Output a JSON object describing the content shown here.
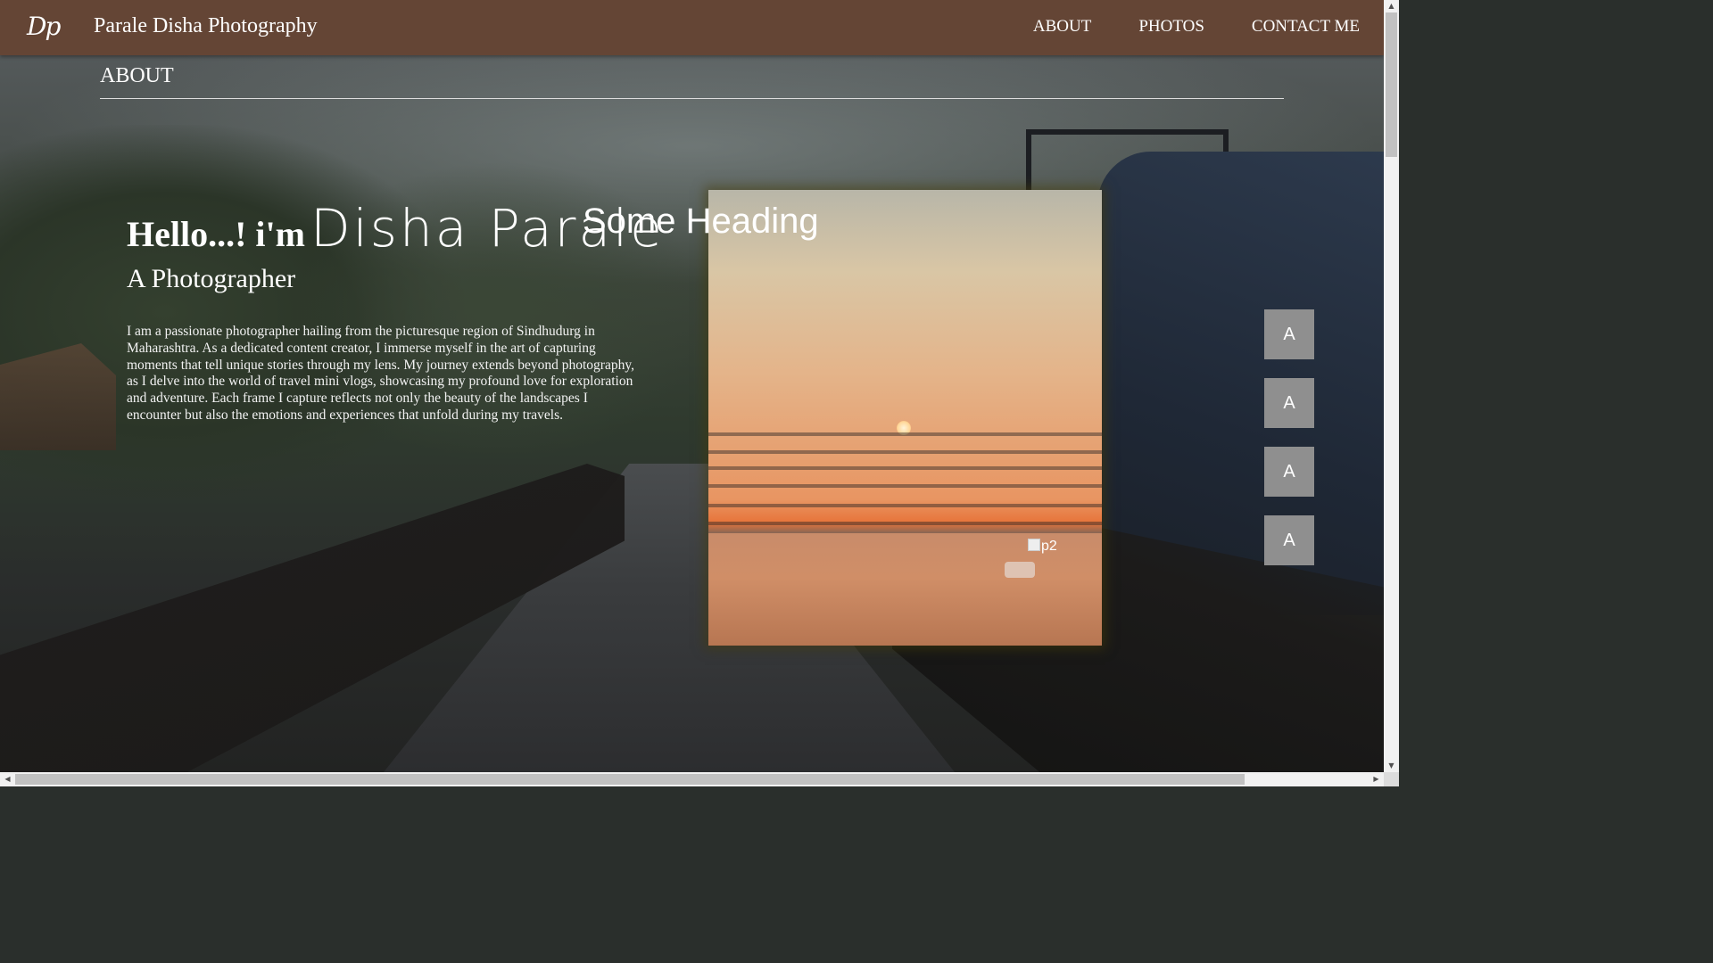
{
  "navbar": {
    "logo": "Dp",
    "brand": "Parale Disha Photography",
    "links": [
      "ABOUT",
      "PHOTOS",
      "CONTACT ME"
    ],
    "background": "#644535"
  },
  "about": {
    "title": "ABOUT",
    "hello_prefix": "Hello...! i'm",
    "name": "Disha Parale",
    "role": "A Photographer",
    "bio": "I am a passionate photographer hailing from the picturesque region of Sindhudurg in Maharashtra. As a dedicated content creator, I immerse myself in the art of capturing moments that tell unique stories through my lens. My journey extends beyond photography, as I delve into the world of travel mini vlogs, showcasing my profound love for exploration and adventure. Each frame I capture reflects not only the beauty of the landscapes I encounter but also the emotions and experiences that unfold during my travels."
  },
  "photo_card": {
    "heading": "Some Heading",
    "broken_image_alt": "p2"
  },
  "side_buttons": [
    "A",
    "A",
    "A",
    "A"
  ],
  "icons": {
    "scroll_up": "scroll-up-arrow-icon",
    "scroll_down": "scroll-down-arrow-icon",
    "scroll_left": "scroll-left-arrow-icon",
    "scroll_right": "scroll-right-arrow-icon"
  }
}
